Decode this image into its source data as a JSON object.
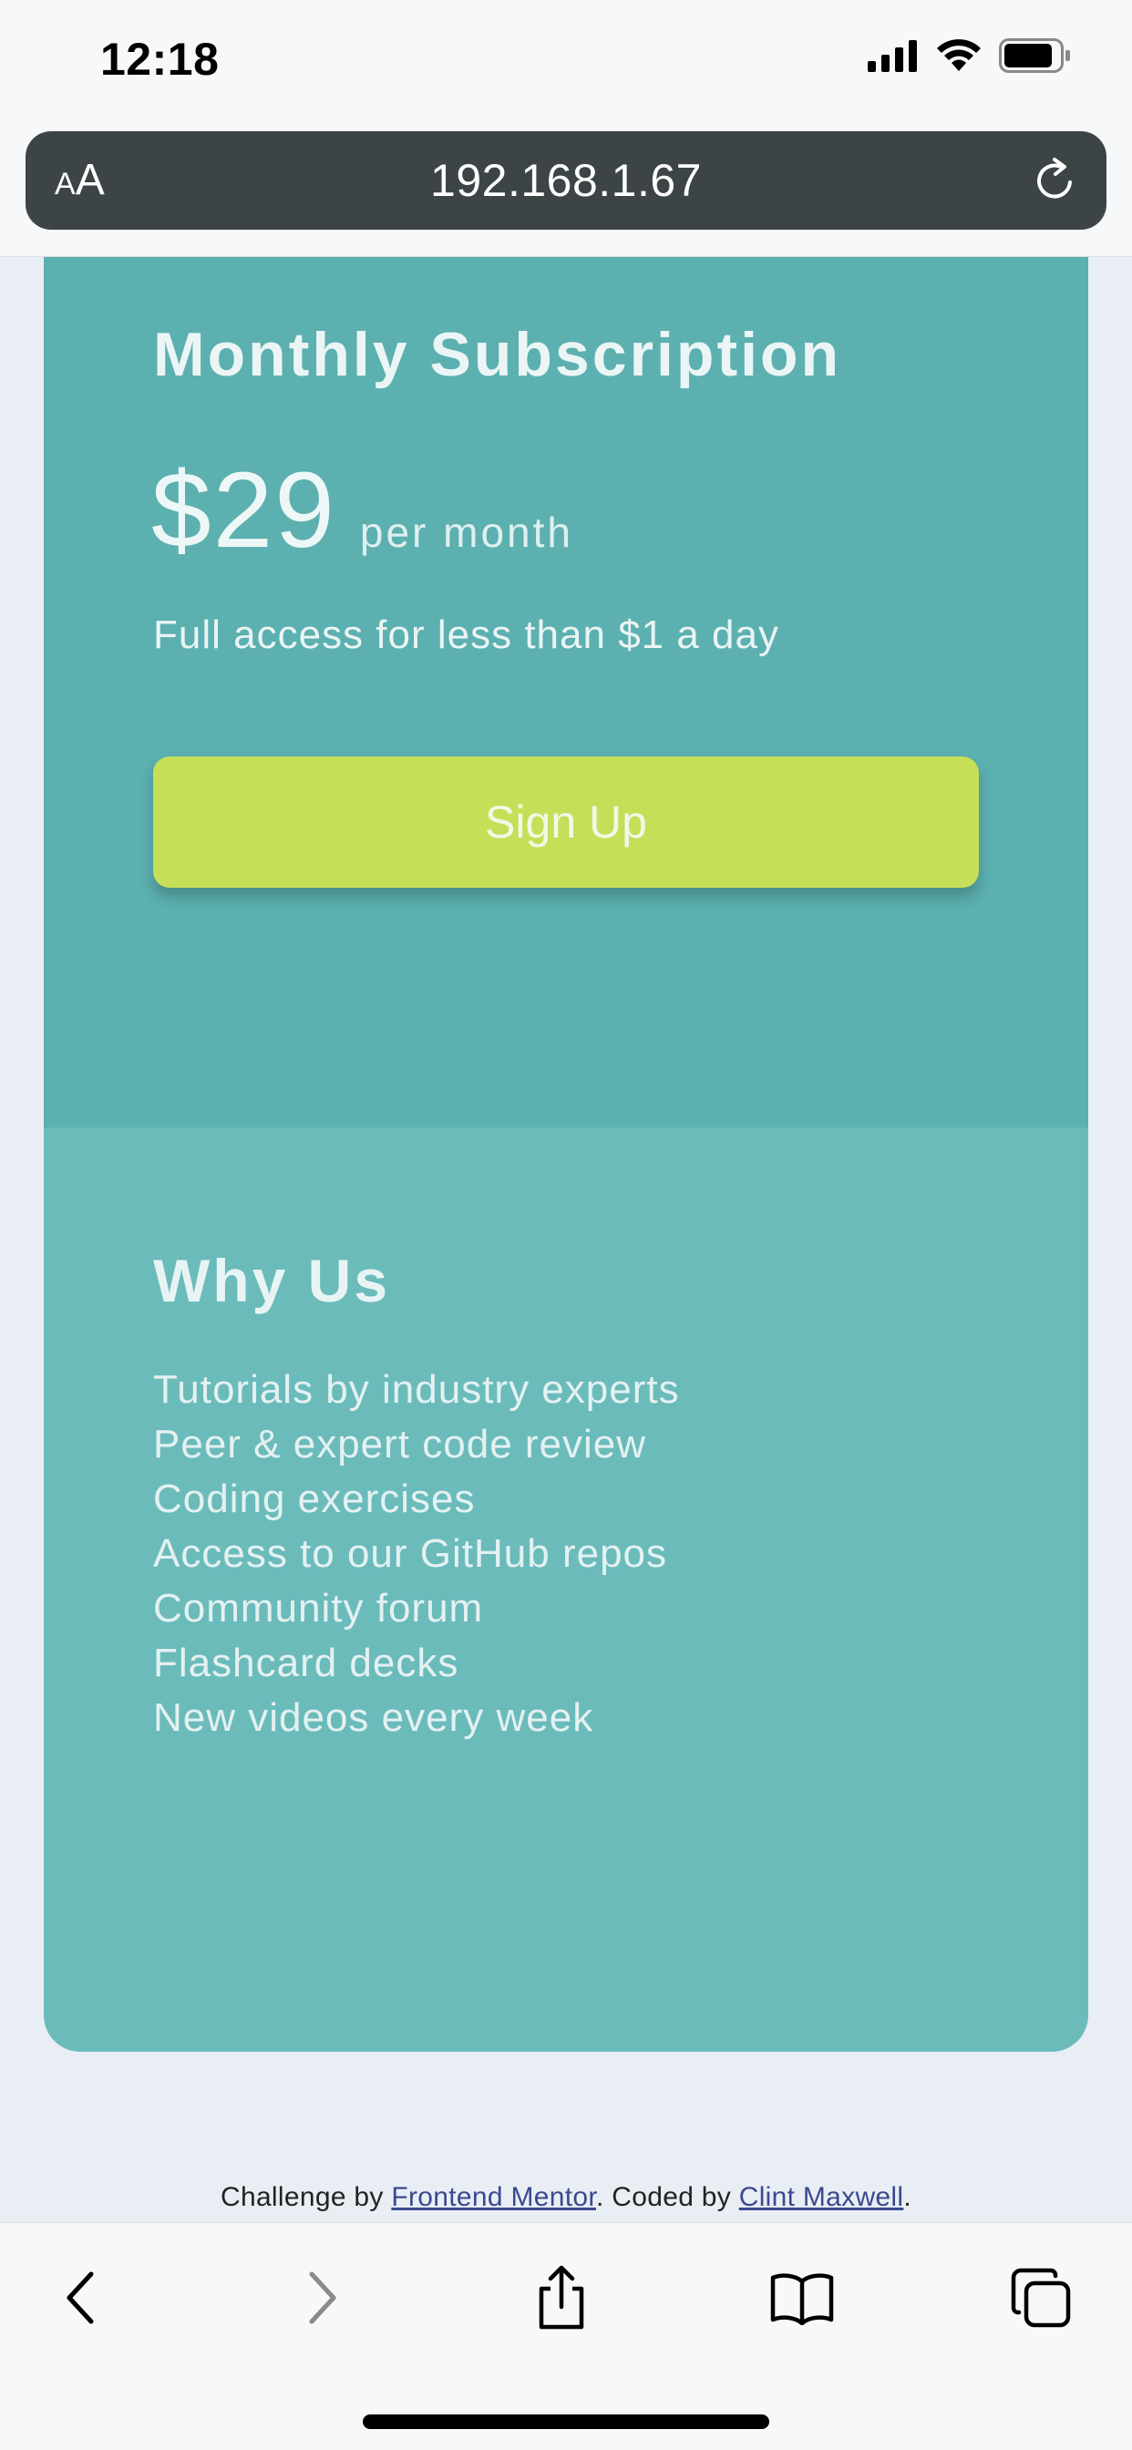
{
  "status_bar": {
    "time": "12:18"
  },
  "browser": {
    "text_size_label": "AA",
    "url": "192.168.1.67"
  },
  "subscription": {
    "title": "Monthly Subscription",
    "price": "$29",
    "period": "per month",
    "tagline": "Full access for less than $1 a day",
    "button_label": "Sign Up"
  },
  "why_us": {
    "title": "Why Us",
    "items": [
      "Tutorials by industry experts",
      "Peer & expert code review",
      "Coding exercises",
      "Access to our GitHub repos",
      "Community forum",
      "Flashcard decks",
      "New videos every week"
    ]
  },
  "attribution": {
    "prefix": "Challenge by",
    "link1": "Frontend Mentor",
    "middle": ". Coded by",
    "link2": "Clint Maxwell",
    "suffix": "."
  },
  "colors": {
    "card_top": "#5cb0b0",
    "card_bottom": "#6bbbbb",
    "button": "#c5df58",
    "page_bg": "#e9eef5"
  },
  "icons": [
    "signal-icon",
    "wifi-icon",
    "battery-icon",
    "reload-icon",
    "back-icon",
    "forward-icon",
    "share-icon",
    "bookmarks-icon",
    "tabs-icon"
  ]
}
